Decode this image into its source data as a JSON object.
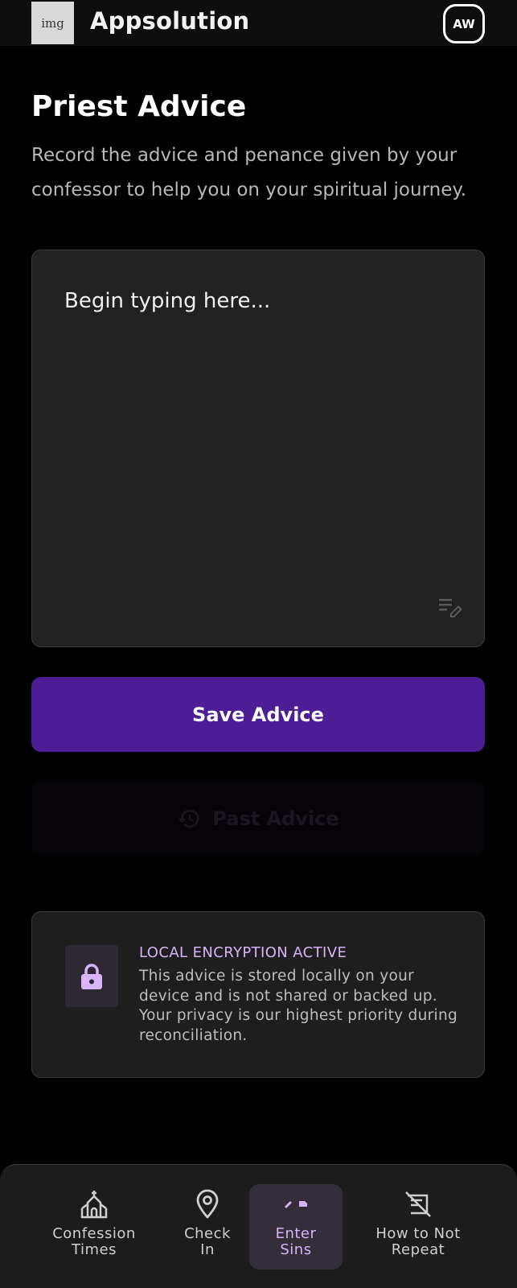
{
  "header": {
    "logo_text": "img",
    "app_title": "Appsolution",
    "avatar_initials": "AW"
  },
  "main": {
    "title": "Priest Advice",
    "subtitle": "Record the advice and penance given by your confessor to help you on your spiritual journey.",
    "editor": {
      "placeholder": "Begin typing here...",
      "value": "",
      "icon": "edit-note-icon"
    },
    "save_button_label": "Save Advice",
    "past_button": {
      "label": "Past Advice",
      "icon": "history-icon",
      "state": "disabled"
    },
    "info_card": {
      "icon": "lock-icon",
      "heading": "LOCAL ENCRYPTION ACTIVE",
      "text": "This advice is stored locally on your device and is not shared or backed up. Your privacy is our highest priority during reconciliation."
    }
  },
  "bottom_nav": {
    "items": [
      {
        "label": "Confession\nTimes",
        "icon": "church-icon",
        "active": false
      },
      {
        "label": "Check\nIn",
        "icon": "location-pin-icon",
        "active": false
      },
      {
        "label": "Enter\nSins",
        "icon": "pencil-tag-icon",
        "active": true
      },
      {
        "label": "How to Not\nRepeat",
        "icon": "no-repeat-icon",
        "active": false
      }
    ]
  },
  "colors": {
    "background": "#000000",
    "accent": "#4c1d95",
    "accent_light": "#d7b4f8",
    "card": "#212121"
  }
}
